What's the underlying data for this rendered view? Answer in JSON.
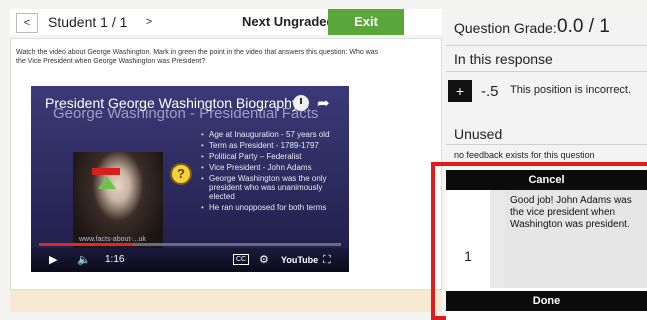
{
  "header": {
    "prev_label": "<",
    "student_label": "Student 1 / 1",
    "next_label": ">",
    "next_ungraded_label": "Next Ungraded",
    "exit_grading_label": "Exit Grading"
  },
  "question": {
    "instructions": "Watch the video about George Washington. Mark in green the point in the video that answers this question: Who was the Vice President when George Washington was President?"
  },
  "video": {
    "title": "President George Washington Biography",
    "title_overlay": "George Washington - Presidential Facts",
    "bullets": [
      "Age at Inauguration - 57 years old",
      "Term as President - 1789-1797",
      "Political Party – Federalist",
      "Vice President - John Adams",
      "George Washington was the only president who was unanimously elected",
      "He ran unopposed for both terms"
    ],
    "watermark": "www.facts-about-...uk",
    "time": "1:16",
    "progress_fraction": 0.31,
    "cc_label": "CC",
    "youtube_label": "YouTube"
  },
  "grading": {
    "question_grade_label": "Question Grade:",
    "question_grade_value": "0.0 / 1",
    "in_response_label": "In this response",
    "add_button": "+",
    "points": "-.5",
    "comment": "This position is incorrect.",
    "unused_label": "Unused",
    "no_feedback": "no feedback exists for this question"
  },
  "popup": {
    "cancel_label": "Cancel",
    "number": "1",
    "feedback_text": "Good job!  John Adams was the vice president when Washington was president.",
    "done_label": "Done"
  },
  "colors": {
    "accent_green": "#5aa63a",
    "highlight_red": "#e11a1a"
  }
}
